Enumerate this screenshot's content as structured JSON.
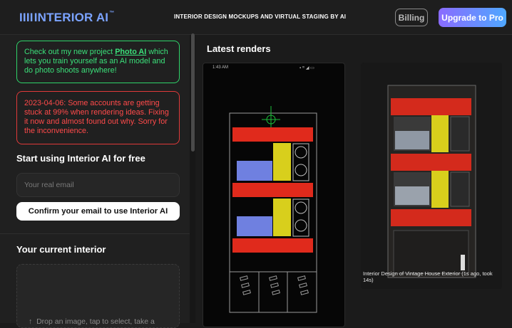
{
  "header": {
    "logo_text": "INTERIOR AI",
    "logo_bars": "IIII",
    "logo_tm": "™",
    "tagline": "INTERIOR DESIGN MOCKUPS AND VIRTUAL STAGING BY AI",
    "billing_label": "Billing",
    "upgrade_label": "Upgrade to Pro"
  },
  "sidebar": {
    "promo_prefix": "Check out my new project ",
    "promo_link": "Photo AI",
    "promo_suffix": " which lets you train yourself as an AI model and do photo shoots anywhere!",
    "notice": "2023-04-06: Some accounts are getting stuck at 99% when rendering ideas. Fixing it now and almost found out why. Sorry for the inconvenience.",
    "start_heading": "Start using Interior AI for free",
    "email_placeholder": "Your real email",
    "confirm_label": "Confirm your email to use Interior AI",
    "current_heading": "Your current interior",
    "drop_text": "Drop an image, tap to select, take a"
  },
  "main": {
    "title": "Latest renders",
    "render1_status_time": "1:43 AM",
    "render1_status_icons": "▪ ᵐ ◢ ▭",
    "render2_caption": "Interior Design of Vintage House Exterior (1s ago, took 14s)"
  },
  "colors": {
    "accent_blue": "#7ba3ff",
    "promo_green": "#2fd46a",
    "notice_red": "#e03a3a",
    "building_red": "#e02a1c",
    "building_yellow": "#d8cf1c",
    "building_blue": "#6f80e0"
  }
}
